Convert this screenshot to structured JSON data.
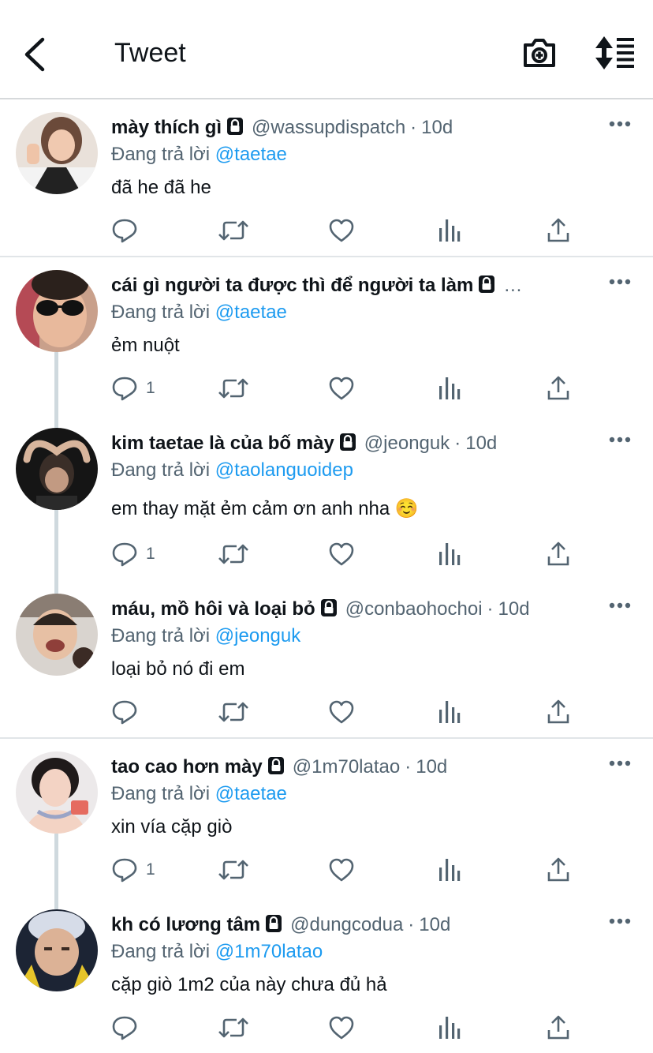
{
  "header": {
    "title": "Tweet"
  },
  "tweets": [
    {
      "name": "mày thích gì",
      "handle": "@wassupdispatch",
      "sep": "·",
      "time": "10d",
      "replying_label": "Đang trả lời",
      "replying_to": "@taetae",
      "text": "đã he đã he",
      "replies": ""
    },
    {
      "name": "cái gì người ta được thì để người ta làm",
      "handle": "…",
      "sep": "",
      "time": "",
      "replying_label": "Đang trả lời",
      "replying_to": "@taetae",
      "text": "ẻm nuột",
      "replies": "1"
    },
    {
      "name": "kim taetae là của bố mày",
      "handle": "@jeonguk",
      "sep": "·",
      "time": "10d",
      "replying_label": "Đang trả lời",
      "replying_to": "@taolanguoidep",
      "text": "em thay mặt ẻm cảm ơn anh nha ☺️",
      "replies": "1"
    },
    {
      "name": "máu, mồ hôi và loại bỏ",
      "handle": "@conbaohochoi",
      "sep": "·",
      "time": "10d",
      "replying_label": "Đang trả lời",
      "replying_to": "@jeonguk",
      "text": "loại bỏ nó đi em",
      "replies": ""
    },
    {
      "name": "tao cao hơn mày",
      "handle": "@1m70latao",
      "sep": "·",
      "time": "10d",
      "replying_label": "Đang trả lời",
      "replying_to": "@taetae",
      "text": "xin vía cặp giò",
      "replies": "1"
    },
    {
      "name": "kh có lương tâm",
      "handle": "@dungcodua",
      "sep": "·",
      "time": "10d",
      "replying_label": "Đang trả lời",
      "replying_to": "@1m70latao",
      "text": "cặp giò 1m2 của này chưa đủ hả",
      "replies": ""
    }
  ],
  "colors": {
    "link": "#1d9bf0",
    "secondary": "#536471",
    "text": "#0f1419",
    "divider": "#e1e5e8"
  },
  "icons": [
    "back-arrow-icon",
    "camera-plus-icon",
    "sort-icon",
    "lock-icon",
    "more-icon",
    "reply-icon",
    "retweet-icon",
    "like-icon",
    "analytics-icon",
    "share-icon"
  ]
}
